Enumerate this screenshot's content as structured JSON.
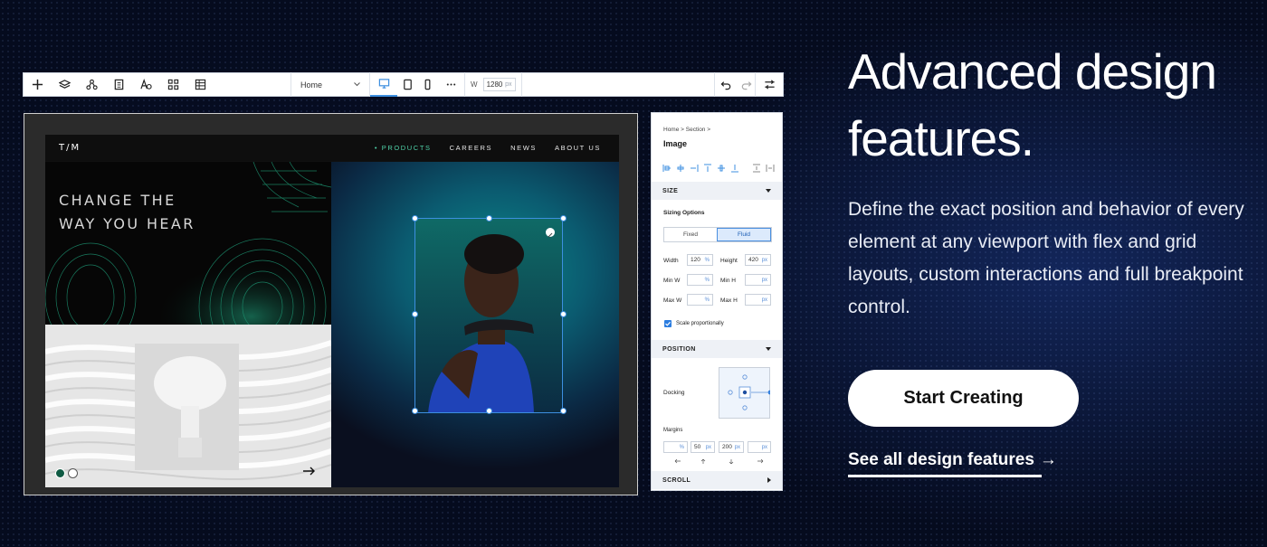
{
  "toolbar": {
    "tools": [
      "plus-icon",
      "layers-icon",
      "connect-icon",
      "pages-icon",
      "text-style-icon",
      "apps-grid-icon",
      "table-icon"
    ],
    "page_select": "Home",
    "width_label": "W",
    "width_value": "1280",
    "width_unit": "px"
  },
  "site": {
    "logo": "T/M",
    "nav": [
      "• PRODUCTS",
      "CAREERS",
      "NEWS",
      "ABOUT US"
    ],
    "hero_line1": "CHANGE THE",
    "hero_line2": "WAY YOU HEAR"
  },
  "panel": {
    "breadcrumb": "Home  >  Section  >",
    "title": "Image",
    "size_header": "SIZE",
    "sizing_options_label": "Sizing Options",
    "sizing_fixed": "Fixed",
    "sizing_fluid": "Fluid",
    "width_label": "Width",
    "width_value": "120",
    "width_unit": "%",
    "height_label": "Height",
    "height_value": "420",
    "height_unit": "px",
    "minw_label": "Min W",
    "minw_unit": "%",
    "minh_label": "Min H",
    "minh_unit": "px",
    "maxw_label": "Max W",
    "maxw_unit": "%",
    "maxh_label": "Max H",
    "maxh_unit": "px",
    "scale_label": "Scale proportionally",
    "position_header": "POSITION",
    "docking_label": "Docking",
    "margins_label": "Margins",
    "margin_values": [
      "",
      "50",
      "200",
      ""
    ],
    "margin_units": [
      "%",
      "px",
      "px",
      "px"
    ],
    "scroll_header": "SCROLL"
  },
  "hero": {
    "headline_line1": "Advanced design",
    "headline_line2": "features.",
    "description": "Define the exact position and behavior of every element at any viewport with flex and grid layouts, custom interactions and full breakpoint control.",
    "cta": "Start Creating",
    "link": "See all design features",
    "link_arrow": "→"
  },
  "colors": {
    "background": "#050b1e",
    "accent_green": "#4fd1a8",
    "selection_blue": "#3d8fe0"
  }
}
